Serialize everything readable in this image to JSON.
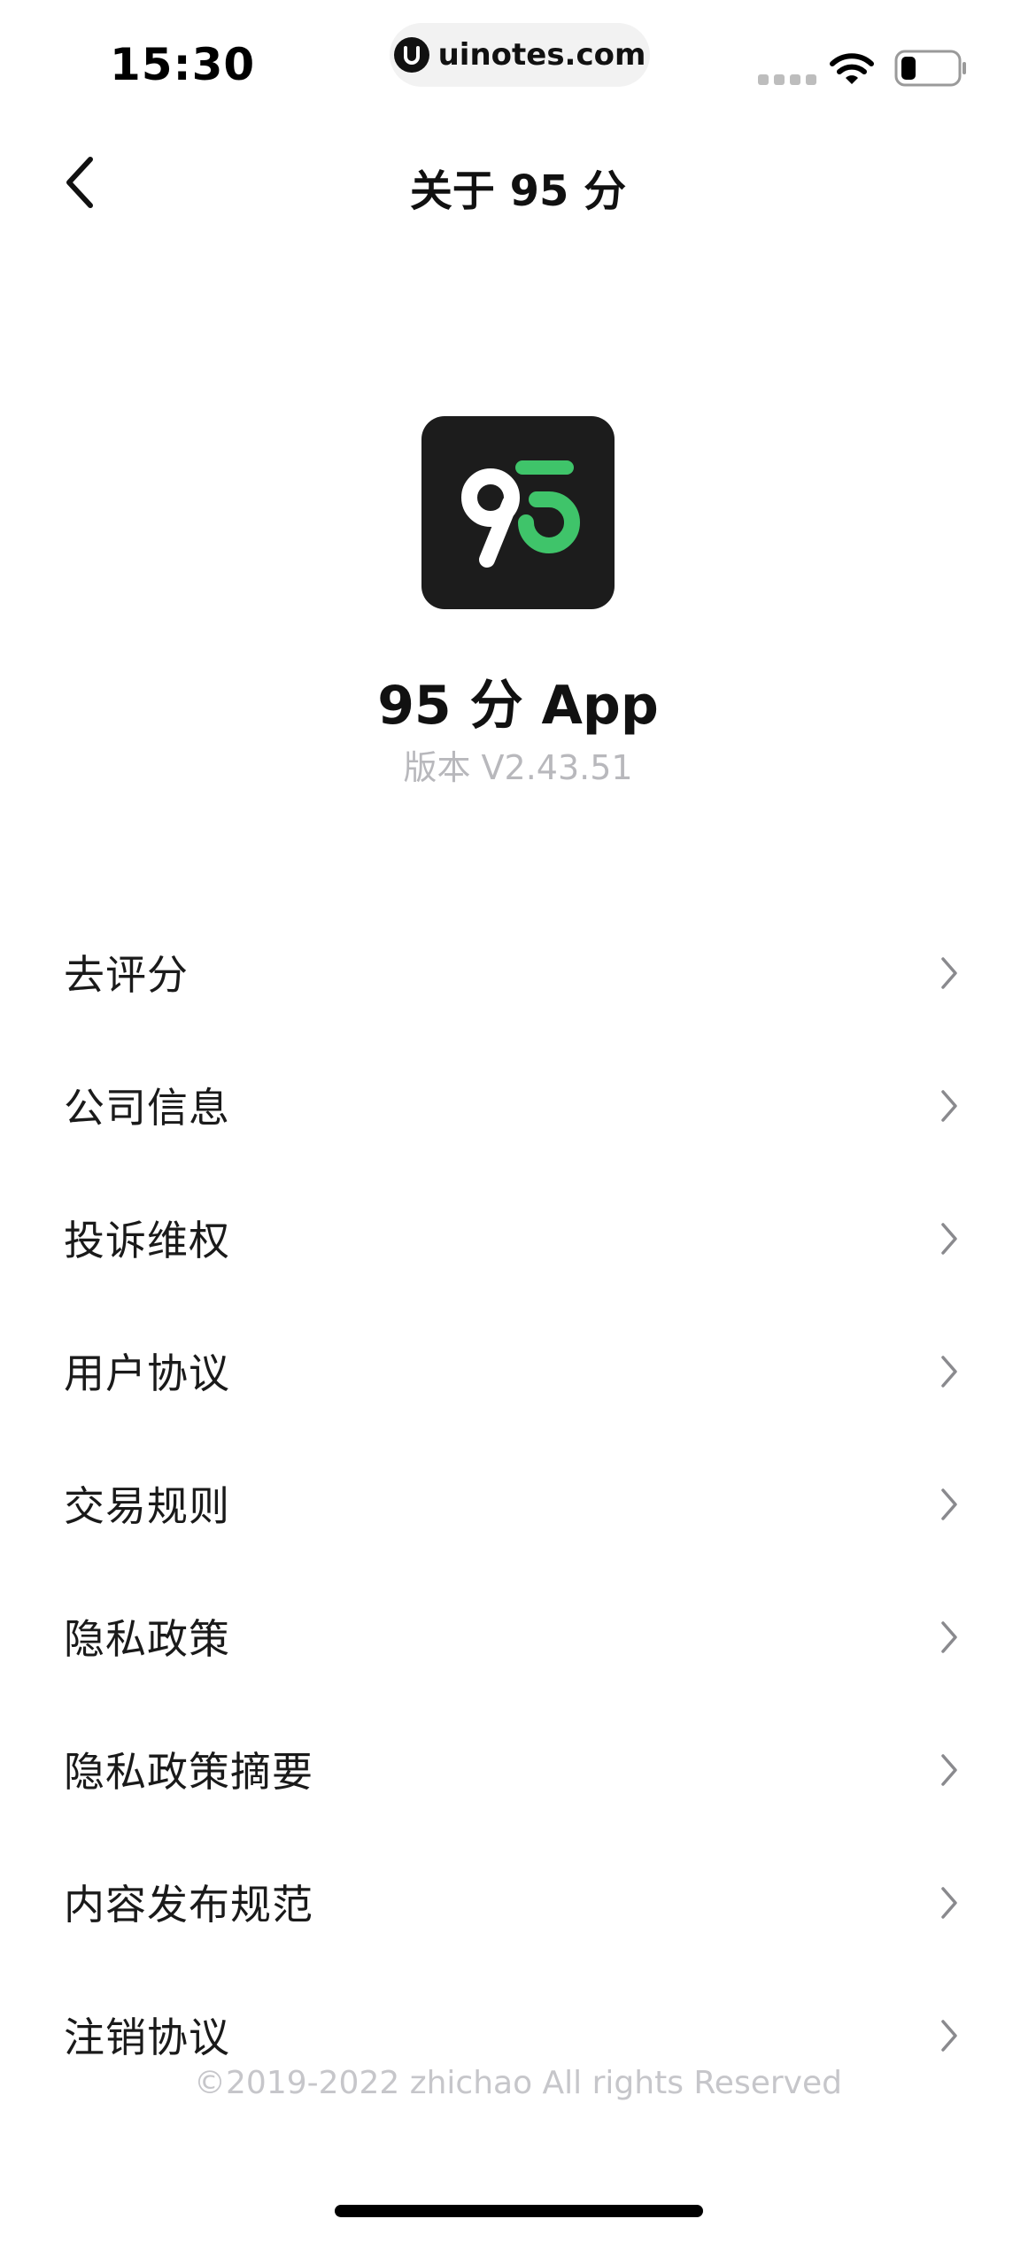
{
  "status_bar": {
    "time": "15:30",
    "url": "uinotes.com",
    "icons": [
      "signal-icon",
      "wifi-icon",
      "battery-icon"
    ]
  },
  "nav": {
    "title": "关于 95 分",
    "back_icon": "chevron-left-icon"
  },
  "app": {
    "name": "95 分 App",
    "version": "版本 V2.43.51",
    "logo_text_left": "9",
    "logo_text_right": "5",
    "logo_bg_color": "#1c1c1c",
    "logo_accent_color": "#3fc46a"
  },
  "menu": {
    "items": [
      {
        "label": "去评分"
      },
      {
        "label": "公司信息"
      },
      {
        "label": "投诉维权"
      },
      {
        "label": "用户协议"
      },
      {
        "label": "交易规则"
      },
      {
        "label": "隐私政策"
      },
      {
        "label": "隐私政策摘要"
      },
      {
        "label": "内容发布规范"
      },
      {
        "label": "注销协议"
      }
    ],
    "chevron_icon": "chevron-right-icon"
  },
  "footer": {
    "copyright": "©2019-2022 zhichao All rights Reserved"
  }
}
